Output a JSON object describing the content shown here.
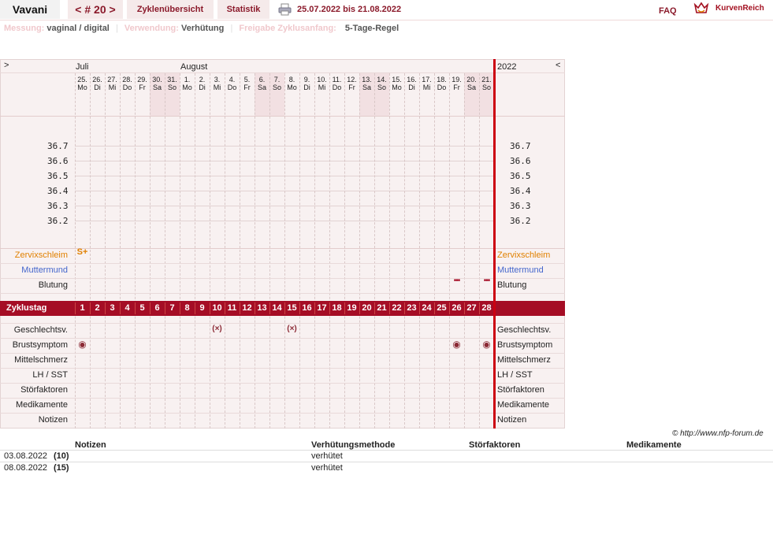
{
  "header": {
    "app_name": "Vavani",
    "cycle_nav": "< # 20 >",
    "tab_overview": "Zyklenübersicht",
    "tab_stats": "Statistik",
    "date_range": "25.07.2022 bis 21.08.2022",
    "faq": "FAQ",
    "logo_text": "KurvenReich"
  },
  "settings": [
    {
      "label": "Messung:",
      "value": "vaginal / digital"
    },
    {
      "label": "Verwendung:",
      "value": "Verhütung"
    },
    {
      "label": "Freigabe Zyklusanfang:",
      "value": "5-Tage-Regel"
    }
  ],
  "chart": {
    "nav_prev": ">",
    "nav_next": "<",
    "year": "2022",
    "months": [
      {
        "label": "Juli",
        "day_index": 0
      },
      {
        "label": "August",
        "day_index": 7
      }
    ],
    "days": [
      {
        "d": "25.",
        "w": "Mo",
        "we": false
      },
      {
        "d": "26.",
        "w": "Di",
        "we": false
      },
      {
        "d": "27.",
        "w": "Mi",
        "we": false
      },
      {
        "d": "28.",
        "w": "Do",
        "we": false
      },
      {
        "d": "29.",
        "w": "Fr",
        "we": false
      },
      {
        "d": "30.",
        "w": "Sa",
        "we": true
      },
      {
        "d": "31.",
        "w": "So",
        "we": true
      },
      {
        "d": "1.",
        "w": "Mo",
        "we": false
      },
      {
        "d": "2.",
        "w": "Di",
        "we": false
      },
      {
        "d": "3.",
        "w": "Mi",
        "we": false
      },
      {
        "d": "4.",
        "w": "Do",
        "we": false
      },
      {
        "d": "5.",
        "w": "Fr",
        "we": false
      },
      {
        "d": "6.",
        "w": "Sa",
        "we": true
      },
      {
        "d": "7.",
        "w": "So",
        "we": true
      },
      {
        "d": "8.",
        "w": "Mo",
        "we": false
      },
      {
        "d": "9.",
        "w": "Di",
        "we": false
      },
      {
        "d": "10.",
        "w": "Mi",
        "we": false
      },
      {
        "d": "11.",
        "w": "Do",
        "we": false
      },
      {
        "d": "12.",
        "w": "Fr",
        "we": false
      },
      {
        "d": "13.",
        "w": "Sa",
        "we": true
      },
      {
        "d": "14.",
        "w": "So",
        "we": true
      },
      {
        "d": "15.",
        "w": "Mo",
        "we": false
      },
      {
        "d": "16.",
        "w": "Di",
        "we": false
      },
      {
        "d": "17.",
        "w": "Mi",
        "we": false
      },
      {
        "d": "18.",
        "w": "Do",
        "we": false
      },
      {
        "d": "19.",
        "w": "Fr",
        "we": false
      },
      {
        "d": "20.",
        "w": "Sa",
        "we": true
      },
      {
        "d": "21.",
        "w": "So",
        "we": true
      }
    ],
    "temps": [
      "36.7",
      "36.6",
      "36.5",
      "36.4",
      "36.3",
      "36.2"
    ],
    "rows_top": [
      {
        "key": "zervix",
        "label": "Zervixschleim",
        "color": "#e08000"
      },
      {
        "key": "muttermund",
        "label": "Muttermund",
        "color": "#4466cc"
      },
      {
        "key": "blutung",
        "label": "Blutung",
        "color": "#222222"
      }
    ],
    "cycle_label": "Zyklustag",
    "cycle_days": [
      "1",
      "2",
      "3",
      "4",
      "5",
      "6",
      "7",
      "8",
      "9",
      "10",
      "11",
      "12",
      "13",
      "14",
      "15",
      "16",
      "17",
      "18",
      "19",
      "20",
      "21",
      "22",
      "23",
      "24",
      "25",
      "26",
      "27",
      "28"
    ],
    "rows_bottom": [
      "Geschlechtsv.",
      "Brustsymptom",
      "Mittelschmerz",
      "LH / SST",
      "Störfaktoren",
      "Medikamente",
      "Notizen"
    ],
    "zervix_marks": [
      {
        "day": 1,
        "symbol": "S+"
      }
    ],
    "blutung_marks": [
      26,
      28
    ],
    "geschlechtsverkehr_marks": [
      10,
      15
    ],
    "brust_marks": [
      1,
      26,
      28
    ],
    "colors": {
      "accent": "#a50d25",
      "grid_bg": "#f8f1f1",
      "weekend": "#f2e0e2",
      "divider": "#cc0011",
      "zervix": "#e08000"
    }
  },
  "copyright": "© http://www.nfp-forum.de",
  "notes": {
    "headers": [
      "Notizen",
      "Verhütungsmethode",
      "Störfaktoren",
      "Medikamente"
    ],
    "rows": [
      {
        "date": "03.08.2022",
        "day": "(10)",
        "note": "",
        "method": "verhütet",
        "stoer": "",
        "med": ""
      },
      {
        "date": "08.08.2022",
        "day": "(15)",
        "note": "",
        "method": "verhütet",
        "stoer": "",
        "med": ""
      }
    ]
  }
}
